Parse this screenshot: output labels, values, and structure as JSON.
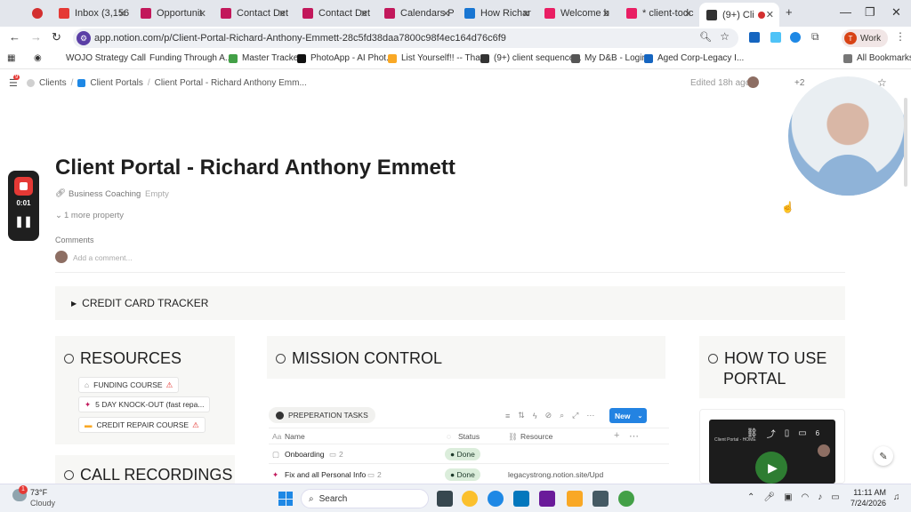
{
  "tabs": [
    {
      "label": "",
      "color": "#d32f2f",
      "close": ""
    },
    {
      "label": "Inbox (3,156",
      "color": "#e53935",
      "close": "✕"
    },
    {
      "label": "Opportunit",
      "color": "#c2185b",
      "close": "✕"
    },
    {
      "label": "Contact Det",
      "color": "#c2185b",
      "close": "✕"
    },
    {
      "label": "Contact Det",
      "color": "#c2185b",
      "close": "✕"
    },
    {
      "label": "Calendars P",
      "color": "#c2185b",
      "close": "✕"
    },
    {
      "label": "How Richar",
      "color": "#1976d2",
      "close": "✕"
    },
    {
      "label": "Welcome b",
      "color": "#e91e63",
      "close": "✕"
    },
    {
      "label": "* client-todc",
      "color": "#e91e63",
      "close": "✕"
    },
    {
      "label": "(9+) Cli",
      "color": "#333333",
      "close": "✕"
    }
  ],
  "newtab": "+",
  "window_controls": {
    "min": "—",
    "max": "❐",
    "close": "✕"
  },
  "address": {
    "url": "app.notion.com/p/Client-Portal-Richard-Anthony-Emmett-28c5fd38daa7800c98f4ec164d76c6f9",
    "profile_letter": "T",
    "profile_label": "Work"
  },
  "bookmarks": [
    "WOJO Strategy Call",
    "Funding Through A...",
    "Master Tracker",
    "PhotoApp - AI Phot...",
    "List Yourself!! -- Tha...",
    "(9+) client sequence...",
    "My D&B - Login",
    "Aged Corp-Legacy I..."
  ],
  "all_bookmarks": "All Bookmarks",
  "breadcrumb": [
    "Clients",
    "/",
    "Client Portals",
    "/",
    "Client Portal - Richard Anthony Emm..."
  ],
  "edited": "Edited 18h ago",
  "share_count": "+2",
  "notification_count": "9",
  "recorder": {
    "time": "0:01"
  },
  "page": {
    "title": "Client Portal - Richard Anthony Emmett",
    "prop_name": "Business Coaching",
    "prop_value": "Empty",
    "more_props": "1 more property",
    "comments_label": "Comments",
    "comment_placeholder": "Add a comment...",
    "toggle": "CREDIT CARD TRACKER"
  },
  "resources": {
    "title": "RESOURCES",
    "items": [
      "FUNDING COURSE",
      "5 DAY KNOCK-OUT (fast repa...",
      "CREDIT REPAIR COURSE"
    ]
  },
  "call_recordings": {
    "title": "CALL RECORDINGS"
  },
  "mission": {
    "title": "MISSION CONTROL",
    "db_title": "PREPERATION TASKS",
    "new_label": "New",
    "columns": [
      "Name",
      "Status",
      "Resource"
    ],
    "rows": [
      {
        "name": "Onboarding",
        "comments": "2",
        "status": "Done",
        "resource": ""
      },
      {
        "name": "Fix and all Personal Info",
        "comments": "2",
        "status": "Done",
        "resource": "legacystrong.notion.site/Upd"
      }
    ]
  },
  "howto": {
    "title_line1": "HOW TO USE",
    "title_line2": "PORTAL",
    "video_count": "6",
    "video_label": "Client Portal - HOME"
  },
  "taskbar": {
    "temp": "73°F",
    "weather": "Cloudy",
    "weather_badge": "1",
    "search": "Search",
    "time": "11:11 AM",
    "date": "7/24/2026"
  }
}
